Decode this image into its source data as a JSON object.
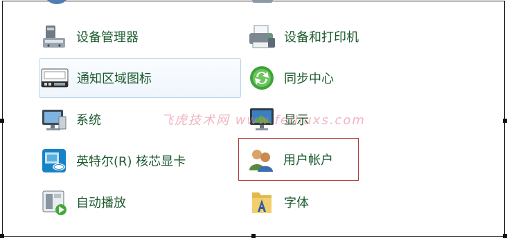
{
  "items": [
    {
      "label": "设备管理器",
      "icon": "device-manager-icon"
    },
    {
      "label": "设备和打印机",
      "icon": "printer-icon"
    },
    {
      "label": "通知区域图标",
      "icon": "notification-area-icon"
    },
    {
      "label": "同步中心",
      "icon": "sync-center-icon"
    },
    {
      "label": "系统",
      "icon": "system-monitor-icon"
    },
    {
      "label": "显示",
      "icon": "display-icon"
    },
    {
      "label": "英特尔(R) 核芯显卡",
      "icon": "intel-graphics-icon"
    },
    {
      "label": "用户帐户",
      "icon": "user-accounts-icon"
    },
    {
      "label": "自动播放",
      "icon": "autoplay-icon"
    },
    {
      "label": "字体",
      "icon": "fonts-folder-icon"
    }
  ],
  "watermark": "飞虎技术网 www.feihuxs.com",
  "colors": {
    "label": "#1c5a2e",
    "hover_border": "#b9d4ea",
    "selected_border": "#b03a3a"
  }
}
